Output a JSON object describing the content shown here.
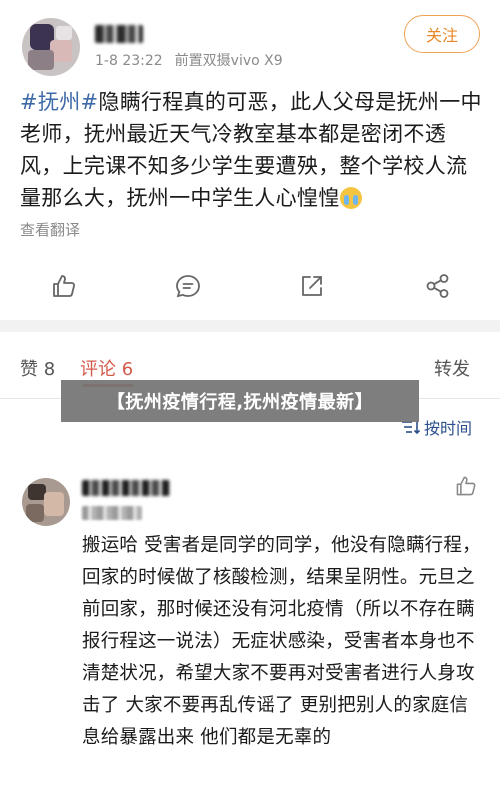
{
  "post": {
    "time": "1-8 23:22",
    "source": "前置双摄vivo X9",
    "follow_label": "关注",
    "hashtag": "#抚州#",
    "body": "隐瞒行程真的可恶，此人父母是抚州一中老师，抚州最近天气冷教室基本都是密闭不透风，上完课不知多少学生要遭殃，整个学校人流量那么大，抚州一中学生人心惶惶",
    "emoji": "crying-face",
    "translate_label": "查看翻译"
  },
  "actions": [
    {
      "name": "like-icon"
    },
    {
      "name": "comment-icon"
    },
    {
      "name": "repost-icon"
    },
    {
      "name": "share-icon"
    }
  ],
  "tabs": {
    "likes": "赞 8",
    "comments": "评论 6",
    "reposts": "转发"
  },
  "overlay": {
    "title": "【抚州疫情行程,抚州疫情最新】"
  },
  "sort": {
    "label": "按时间"
  },
  "comment": {
    "text": "搬运哈 受害者是同学的同学，他没有隐瞒行程，回家的时候做了核酸检测，结果呈阴性。元旦之前回家，那时候还没有河北疫情（所以不存在瞒报行程这一说法）无症状感染，受害者本身也不清楚状况，希望大家不要再对受害者进行人身攻击了 大家不要再乱传谣了 更别把别人的家庭信息给暴露出来 他们都是无辜的"
  },
  "colors": {
    "accent_orange": "#e8892a",
    "hashtag_blue": "#3f6aa8",
    "comments_tab": "#d35b4b",
    "sort_blue": "#2b4f8a"
  }
}
